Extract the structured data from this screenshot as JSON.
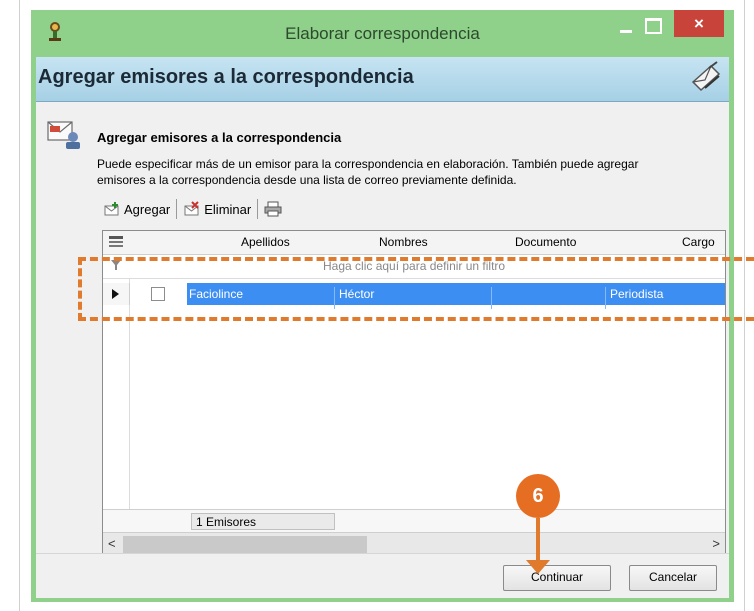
{
  "window": {
    "title": "Elaborar correspondencia",
    "close_label": "×"
  },
  "header": {
    "title": "Agregar emisores a la correspondencia"
  },
  "section": {
    "title": "Agregar emisores a la correspondencia",
    "description_line1": "Puede especificar más de un emisor para la correspondencia en elaboración. También puede agregar",
    "description_line2": "emisores a la correspondencia desde una lista de correo previamente definida."
  },
  "toolbar": {
    "add_label": "Agregar",
    "delete_label": "Eliminar",
    "print_icon": "printer-icon"
  },
  "grid": {
    "columns": [
      "Apellidos",
      "Nombres",
      "Documento",
      "Cargo"
    ],
    "filter_placeholder": "Haga clic aquí para definir un filtro",
    "rows": [
      {
        "apellidos": "Faciolince",
        "nombres": "Héctor",
        "documento": "",
        "cargo": "Periodista",
        "selected": true
      }
    ],
    "footer_count": "1 Emisores"
  },
  "buttons": {
    "continue": "Continuar",
    "cancel": "Cancelar"
  },
  "callout": {
    "step": "6"
  },
  "colors": {
    "window_frame": "#8fd08a",
    "close_button": "#c8433a",
    "selection": "#3d8ef2",
    "callout": "#e56e22"
  }
}
